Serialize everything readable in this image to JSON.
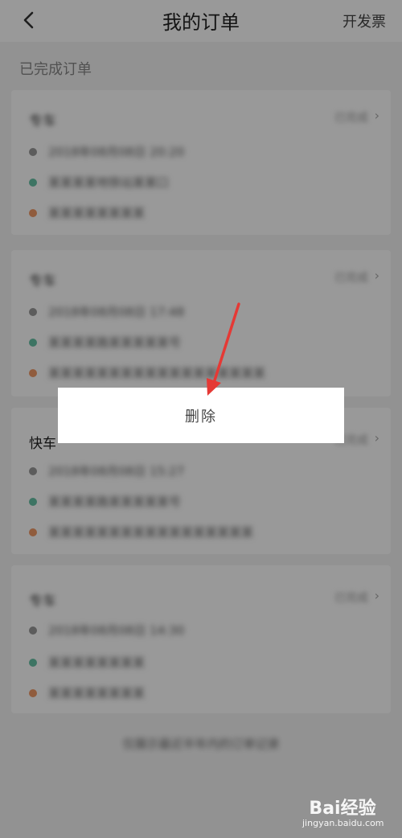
{
  "header": {
    "title": "我的订单",
    "invoice_label": "开发票",
    "back_icon": "chevron-left-icon"
  },
  "section": {
    "label": "已完成订单"
  },
  "orders": [
    {
      "type": "专车",
      "status": "已完成",
      "time": "2018年08月08日 20:20",
      "from": "某某某某地铁站某某口",
      "to": "某某某某某某某某"
    },
    {
      "type": "专车",
      "status": "已完成",
      "time": "2018年08月08日 17:48",
      "from": "某某某某路某某某某某号",
      "to": "某某某某某某某某某某某某某某某某某某"
    },
    {
      "type": "快车",
      "status": "已完成",
      "time": "2018年08月08日 15:27",
      "from": "某某某某路某某某某某号",
      "to": "某某某某某某某某某某某某某某某某某"
    },
    {
      "type": "专车",
      "status": "已完成",
      "time": "2018年08月08日 14:30",
      "from": "某某某某某某某某",
      "to": "某某某某某某某某"
    }
  ],
  "footer_note": "仅展示最近半年内的订单记录",
  "popup": {
    "delete_label": "删除"
  },
  "annotation": {
    "arrow_color": "#e53935"
  },
  "watermark": {
    "logo": "Bai经验",
    "url": "jingyan.baidu.com"
  }
}
